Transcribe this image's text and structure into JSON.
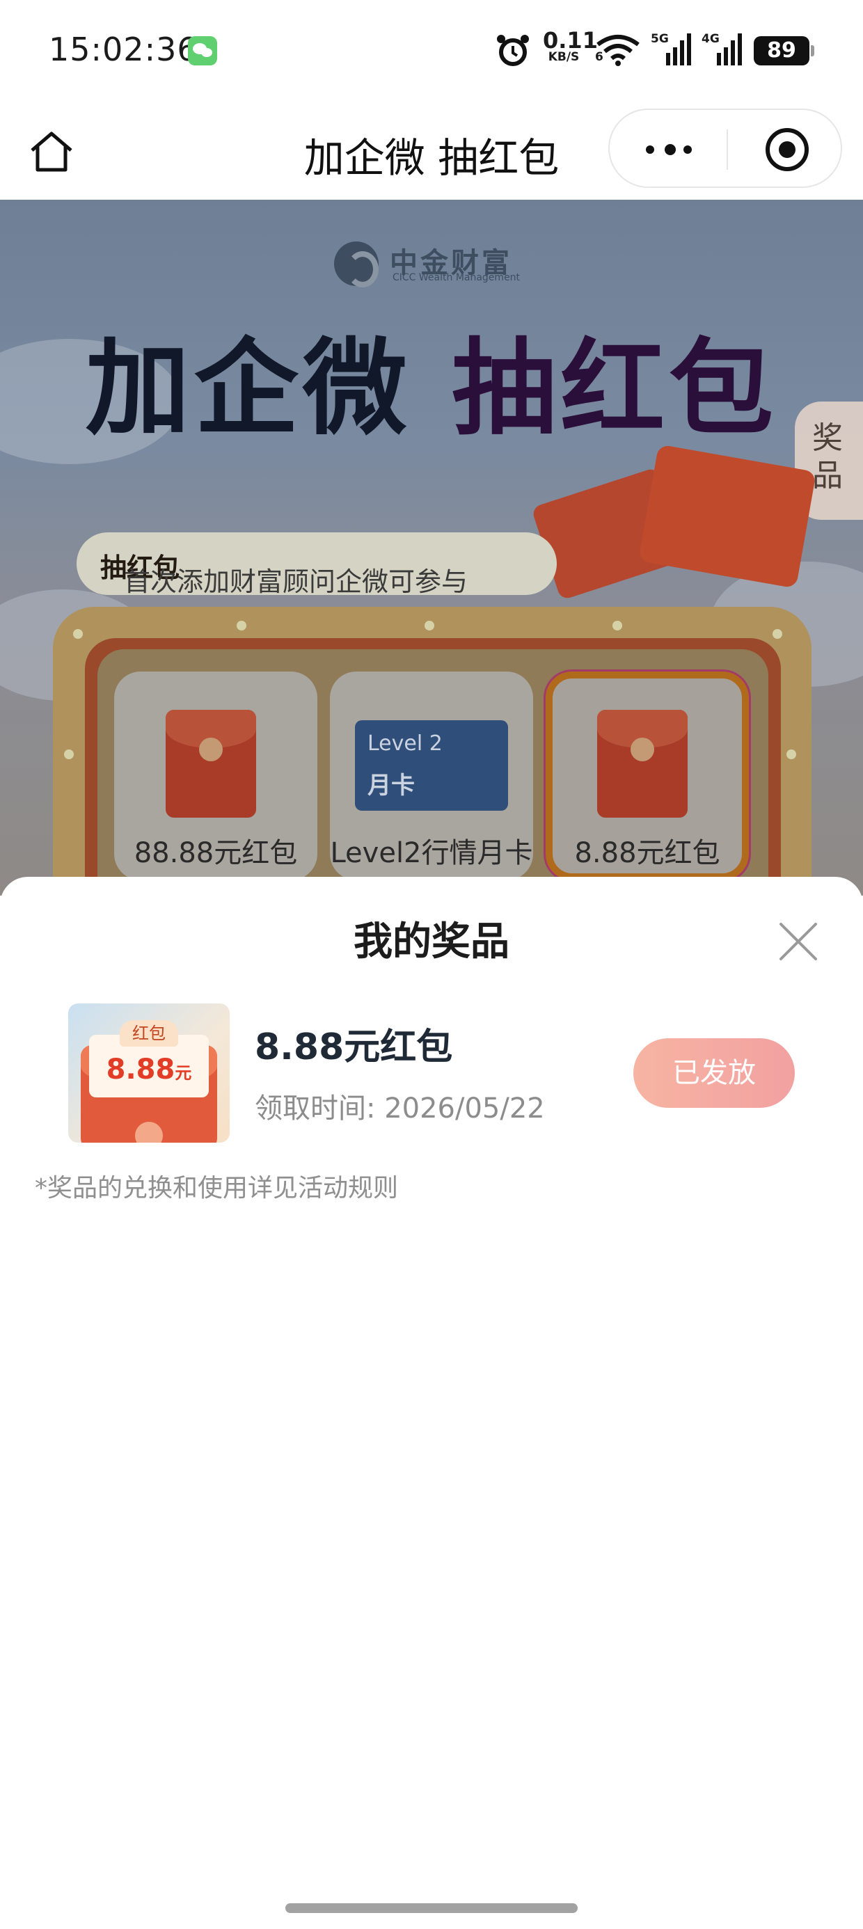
{
  "status_bar": {
    "time": "15:02:36",
    "net_speed_value": "0.11",
    "net_speed_unit": "KB/S",
    "wifi_label": "6",
    "signal1_label": "5G",
    "signal2_label": "4G",
    "battery": "89"
  },
  "nav": {
    "title": "加企微 抽红包"
  },
  "banner": {
    "brand_name": "中金财富",
    "brand_sub": "CICC Wealth Management",
    "title_part1": "加企微",
    "title_part2": "抽红包",
    "prize_tab": "奖品",
    "pill_text": "首次添加财富顾问企微可参与",
    "pill_highlight": "抽红包",
    "prizes": [
      {
        "name": "88.88元红包"
      },
      {
        "name": "Level2行情月卡",
        "card_line1": "Level 2",
        "card_line2": "月卡"
      },
      {
        "name": "8.88元红包"
      }
    ]
  },
  "sheet": {
    "title": "我的奖品",
    "records": [
      {
        "thumb_tag": "红包",
        "thumb_amount": "8.88",
        "thumb_unit": "元",
        "name": "8.88元红包",
        "time_label": "领取时间: 2026/05/22",
        "status": "已发放"
      }
    ],
    "footnote": "*奖品的兑换和使用详见活动规则"
  },
  "colors": {
    "status_button": "#f2a1a1",
    "record_name": "#1f2a36",
    "muted_text": "#8c8c8c"
  }
}
